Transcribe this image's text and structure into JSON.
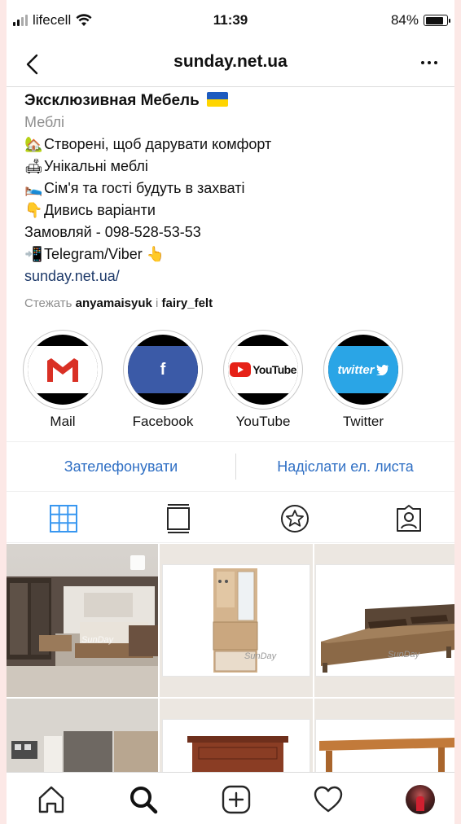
{
  "status_bar": {
    "carrier": "lifecell",
    "time": "11:39",
    "battery": "84%",
    "battery_level": 0.84
  },
  "nav": {
    "title": "sunday.net.ua"
  },
  "profile": {
    "name": "Эксклюзивная Мебель",
    "category": "Меблі",
    "bio_lines": [
      {
        "emoji": "🏡",
        "text": "Створені, щоб дарувати комфорт"
      },
      {
        "emoji": "🛋",
        "text": "Унікальні меблі"
      },
      {
        "emoji": "🛌",
        "text": "Сім'я та гості будуть в захваті"
      },
      {
        "emoji": "👇",
        "text": "Дивись варіанти"
      },
      {
        "emoji": "",
        "text": "Замовляй - 098-528-53-53"
      },
      {
        "emoji": "📲",
        "text": "Telegram/Viber 👆"
      }
    ],
    "link": "sunday.net.ua/",
    "followed_by_prefix": "Стежать",
    "followed_by_user1": "anyamaisyuk",
    "followed_by_joiner": "і",
    "followed_by_user2": "fairy_felt"
  },
  "highlights": [
    {
      "label": "Mail",
      "logo": "gmail-icon"
    },
    {
      "label": "Facebook",
      "logo": "facebook-icon"
    },
    {
      "label": "YouTube",
      "logo": "youtube-icon"
    },
    {
      "label": "Twitter",
      "logo": "twitter-icon"
    }
  ],
  "actions": {
    "call": "Зателефонувати",
    "email": "Надіслати ел. листа"
  },
  "logos": {
    "youtube": "YouTube",
    "twitter": "twitter",
    "facebook": "f",
    "watermark": "SunDay"
  },
  "colors": {
    "accent": "#2f6fc4",
    "link": "#1e3a6a",
    "muted": "#8e8e8e",
    "flag_blue": "#1d5bbf",
    "flag_yellow": "#ffd500"
  }
}
